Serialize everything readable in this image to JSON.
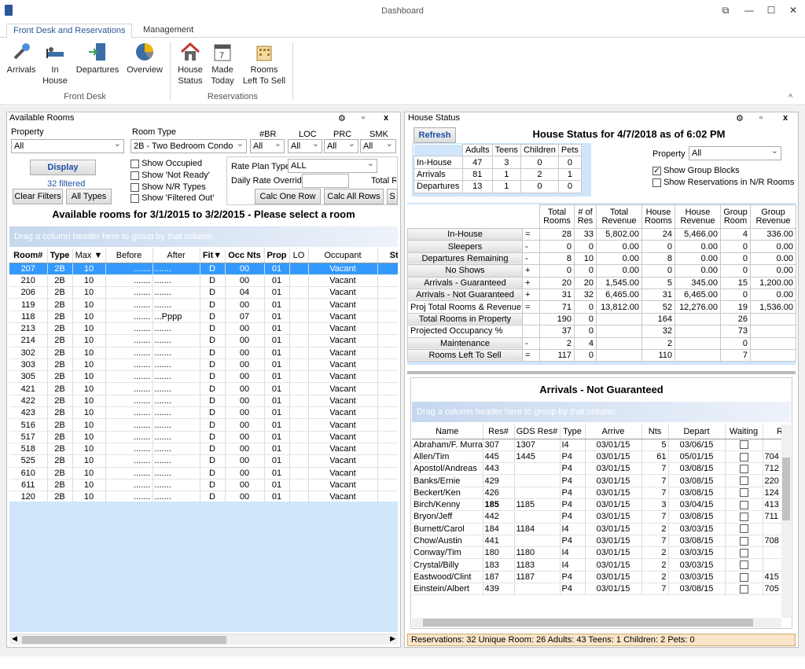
{
  "window": {
    "title": "Dashboard"
  },
  "ribbon": {
    "tabs": [
      "Front Desk and Reservations",
      "Management"
    ],
    "front_desk": {
      "label": "Front Desk",
      "buttons": [
        "Arrivals",
        "In House",
        "Departures",
        "Overview"
      ]
    },
    "reservations": {
      "label": "Reservations",
      "buttons": [
        "House Status",
        "Made Today",
        "Rooms Left To Sell"
      ]
    }
  },
  "available": {
    "title": "Available Rooms",
    "property_label": "Property",
    "property_value": "All",
    "roomtype_label": "Room Type",
    "roomtype_value": "2B - Two Bedroom Condo",
    "br_label": "#BR",
    "br_value": "All",
    "loc_label": "LOC",
    "loc_value": "All",
    "prc_label": "PRC",
    "prc_value": "All",
    "smk_label": "SMK",
    "smk_value": "All",
    "display_btn": "Display",
    "filtered": "32 filtered",
    "clear_btn": "Clear Filters",
    "alltypes_btn": "All Types",
    "checks": [
      "Show Occupied",
      "Show 'Not Ready'",
      "Show N/R Types",
      "Show 'Filtered Out'"
    ],
    "rateplan_label": "Rate Plan Type",
    "rateplan_value": "ALL",
    "override_label": "Daily Rate Override",
    "total_label": "Total Ra",
    "calc_one": "Calc One Row",
    "calc_all": "Calc All Rows",
    "s_btn": "S",
    "grid_title": "Available rooms for 3/1/2015 to 3/2/2015 - Please select a room",
    "group_hint": "Drag a column header here to group by that column.",
    "columns": [
      "Room#",
      "Type",
      "Max",
      "Before",
      "After",
      "Fit",
      "Occ Nts",
      "Prop",
      "LO",
      "Occupant",
      "Stat"
    ],
    "rows": [
      [
        "207",
        "2B",
        "10",
        ".......",
        ".......",
        "D",
        "00",
        "01",
        "",
        "Vacant"
      ],
      [
        "210",
        "2B",
        "10",
        ".......",
        ".......",
        "D",
        "00",
        "01",
        "",
        "Vacant"
      ],
      [
        "206",
        "2B",
        "10",
        ".......",
        ".......",
        "D",
        "04",
        "01",
        "",
        "Vacant"
      ],
      [
        "119",
        "2B",
        "10",
        ".......",
        ".......",
        "D",
        "00",
        "01",
        "",
        "Vacant"
      ],
      [
        "118",
        "2B",
        "10",
        ".......",
        "...Pppp",
        "D",
        "07",
        "01",
        "",
        "Vacant"
      ],
      [
        "213",
        "2B",
        "10",
        ".......",
        ".......",
        "D",
        "00",
        "01",
        "",
        "Vacant"
      ],
      [
        "214",
        "2B",
        "10",
        ".......",
        ".......",
        "D",
        "00",
        "01",
        "",
        "Vacant"
      ],
      [
        "302",
        "2B",
        "10",
        ".......",
        ".......",
        "D",
        "00",
        "01",
        "",
        "Vacant"
      ],
      [
        "303",
        "2B",
        "10",
        ".......",
        ".......",
        "D",
        "00",
        "01",
        "",
        "Vacant"
      ],
      [
        "305",
        "2B",
        "10",
        ".......",
        ".......",
        "D",
        "00",
        "01",
        "",
        "Vacant"
      ],
      [
        "421",
        "2B",
        "10",
        ".......",
        ".......",
        "D",
        "00",
        "01",
        "",
        "Vacant"
      ],
      [
        "422",
        "2B",
        "10",
        ".......",
        ".......",
        "D",
        "00",
        "01",
        "",
        "Vacant"
      ],
      [
        "423",
        "2B",
        "10",
        ".......",
        ".......",
        "D",
        "00",
        "01",
        "",
        "Vacant"
      ],
      [
        "516",
        "2B",
        "10",
        ".......",
        ".......",
        "D",
        "00",
        "01",
        "",
        "Vacant"
      ],
      [
        "517",
        "2B",
        "10",
        ".......",
        ".......",
        "D",
        "00",
        "01",
        "",
        "Vacant"
      ],
      [
        "518",
        "2B",
        "10",
        ".......",
        ".......",
        "D",
        "00",
        "01",
        "",
        "Vacant"
      ],
      [
        "525",
        "2B",
        "10",
        ".......",
        ".......",
        "D",
        "00",
        "01",
        "",
        "Vacant"
      ],
      [
        "610",
        "2B",
        "10",
        ".......",
        ".......",
        "D",
        "00",
        "01",
        "",
        "Vacant"
      ],
      [
        "611",
        "2B",
        "10",
        ".......",
        ".......",
        "D",
        "00",
        "01",
        "",
        "Vacant"
      ],
      [
        "120",
        "2B",
        "10",
        ".......",
        ".......",
        "D",
        "00",
        "01",
        "",
        "Vacant"
      ]
    ]
  },
  "house": {
    "title": "House Status",
    "refresh_btn": "Refresh",
    "heading": "House Status for 4/7/2018 as of 6:02 PM",
    "mini_cols": [
      "Adults",
      "Teens",
      "Children",
      "Pets"
    ],
    "mini_rows": [
      [
        "In-House",
        "47",
        "3",
        "0",
        "0"
      ],
      [
        "Arrivals",
        "81",
        "1",
        "2",
        "1"
      ],
      [
        "Departures",
        "13",
        "1",
        "0",
        "0"
      ]
    ],
    "property_label": "Property",
    "property_value": "All",
    "show_group": "Show Group Blocks",
    "show_nr": "Show Reservations in N/R Rooms",
    "cols": [
      "Total Rooms",
      "# of Res",
      "Total Revenue",
      "House Rooms",
      "House Revenue",
      "Group Room",
      "Group Revenue"
    ],
    "rows": [
      {
        "label": "In-House",
        "op": "=",
        "v": [
          "28",
          "33",
          "5,802.00",
          "24",
          "5,466.00",
          "4",
          "336.00"
        ],
        "btn": true
      },
      {
        "label": "Sleepers",
        "op": "-",
        "v": [
          "0",
          "0",
          "0.00",
          "0",
          "0.00",
          "0",
          "0.00"
        ],
        "btn": true
      },
      {
        "label": "Departures Remaining",
        "op": "-",
        "v": [
          "8",
          "10",
          "0.00",
          "8",
          "0.00",
          "0",
          "0.00"
        ],
        "btn": true
      },
      {
        "label": "No Shows",
        "op": "+",
        "v": [
          "0",
          "0",
          "0.00",
          "0",
          "0.00",
          "0",
          "0.00"
        ],
        "btn": true
      },
      {
        "label": "Arrivals - Guaranteed",
        "op": "+",
        "v": [
          "20",
          "20",
          "1,545.00",
          "5",
          "345.00",
          "15",
          "1,200.00"
        ],
        "btn": true
      },
      {
        "label": "Arrivals - Not Guaranteed",
        "op": "+",
        "v": [
          "31",
          "32",
          "6,465.00",
          "31",
          "6,465.00",
          "0",
          "0.00"
        ],
        "btn": true
      },
      {
        "label": "Proj Total Rooms & Revenue",
        "op": "=",
        "v": [
          "71",
          "0",
          "13,812.00",
          "52",
          "12,276.00",
          "19",
          "1,536.00"
        ],
        "btn": false
      },
      {
        "label": "Total Rooms in Property",
        "op": "",
        "v": [
          "190",
          "0",
          "",
          "164",
          "",
          "26",
          ""
        ],
        "btn": true
      },
      {
        "label": "Projected Occupancy %",
        "op": "",
        "v": [
          "37",
          "0",
          "",
          "32",
          "",
          "73",
          ""
        ],
        "btn": false
      },
      {
        "label": "Maintenance",
        "op": "-",
        "v": [
          "2",
          "4",
          "",
          "2",
          "",
          "0",
          ""
        ],
        "btn": true
      },
      {
        "label": "Rooms Left To Sell",
        "op": "=",
        "v": [
          "117",
          "0",
          "",
          "110",
          "",
          "7",
          ""
        ],
        "btn": true
      }
    ]
  },
  "arrivals": {
    "title": "Arrivals - Not Guaranteed",
    "group_hint": "Drag a column header here to group by that column.",
    "columns": [
      "Name",
      "Res#",
      "GDS Res#",
      "Type",
      "Arrive",
      "Nts",
      "Depart",
      "Waiting",
      "R"
    ],
    "rows": [
      [
        "Abraham/F. Murray",
        "307",
        "1307",
        "I4",
        "03/01/15",
        "5",
        "03/06/15",
        ""
      ],
      [
        "Allen/Tim",
        "445",
        "1445",
        "P4",
        "03/01/15",
        "61",
        "05/01/15",
        "704"
      ],
      [
        "Apostol/Andreas",
        "443",
        "",
        "P4",
        "03/01/15",
        "7",
        "03/08/15",
        "712"
      ],
      [
        "Banks/Ernie",
        "429",
        "",
        "P4",
        "03/01/15",
        "7",
        "03/08/15",
        "220"
      ],
      [
        "Beckert/Ken",
        "426",
        "",
        "P4",
        "03/01/15",
        "7",
        "03/08/15",
        "124"
      ],
      [
        "Birch/Kenny",
        "185",
        "1185",
        "P4",
        "03/01/15",
        "3",
        "03/04/15",
        "413"
      ],
      [
        "Bryon/Jeff",
        "442",
        "",
        "P4",
        "03/01/15",
        "7",
        "03/08/15",
        "711"
      ],
      [
        "Burnett/Carol",
        "184",
        "1184",
        "I4",
        "03/01/15",
        "2",
        "03/03/15",
        ""
      ],
      [
        "Chow/Austin",
        "441",
        "",
        "P4",
        "03/01/15",
        "7",
        "03/08/15",
        "708"
      ],
      [
        "Conway/Tim",
        "180",
        "1180",
        "I4",
        "03/01/15",
        "2",
        "03/03/15",
        ""
      ],
      [
        "Crystal/Billy",
        "183",
        "1183",
        "I4",
        "03/01/15",
        "2",
        "03/03/15",
        ""
      ],
      [
        "Eastwood/Clint",
        "187",
        "1187",
        "P4",
        "03/01/15",
        "2",
        "03/03/15",
        "415"
      ],
      [
        "Einstein/Albert",
        "439",
        "",
        "P4",
        "03/01/15",
        "7",
        "03/08/15",
        "705"
      ]
    ],
    "status": "Reservations: 32   Unique Room: 26   Adults: 43   Teens: 1   Children: 2   Pets: 0"
  }
}
